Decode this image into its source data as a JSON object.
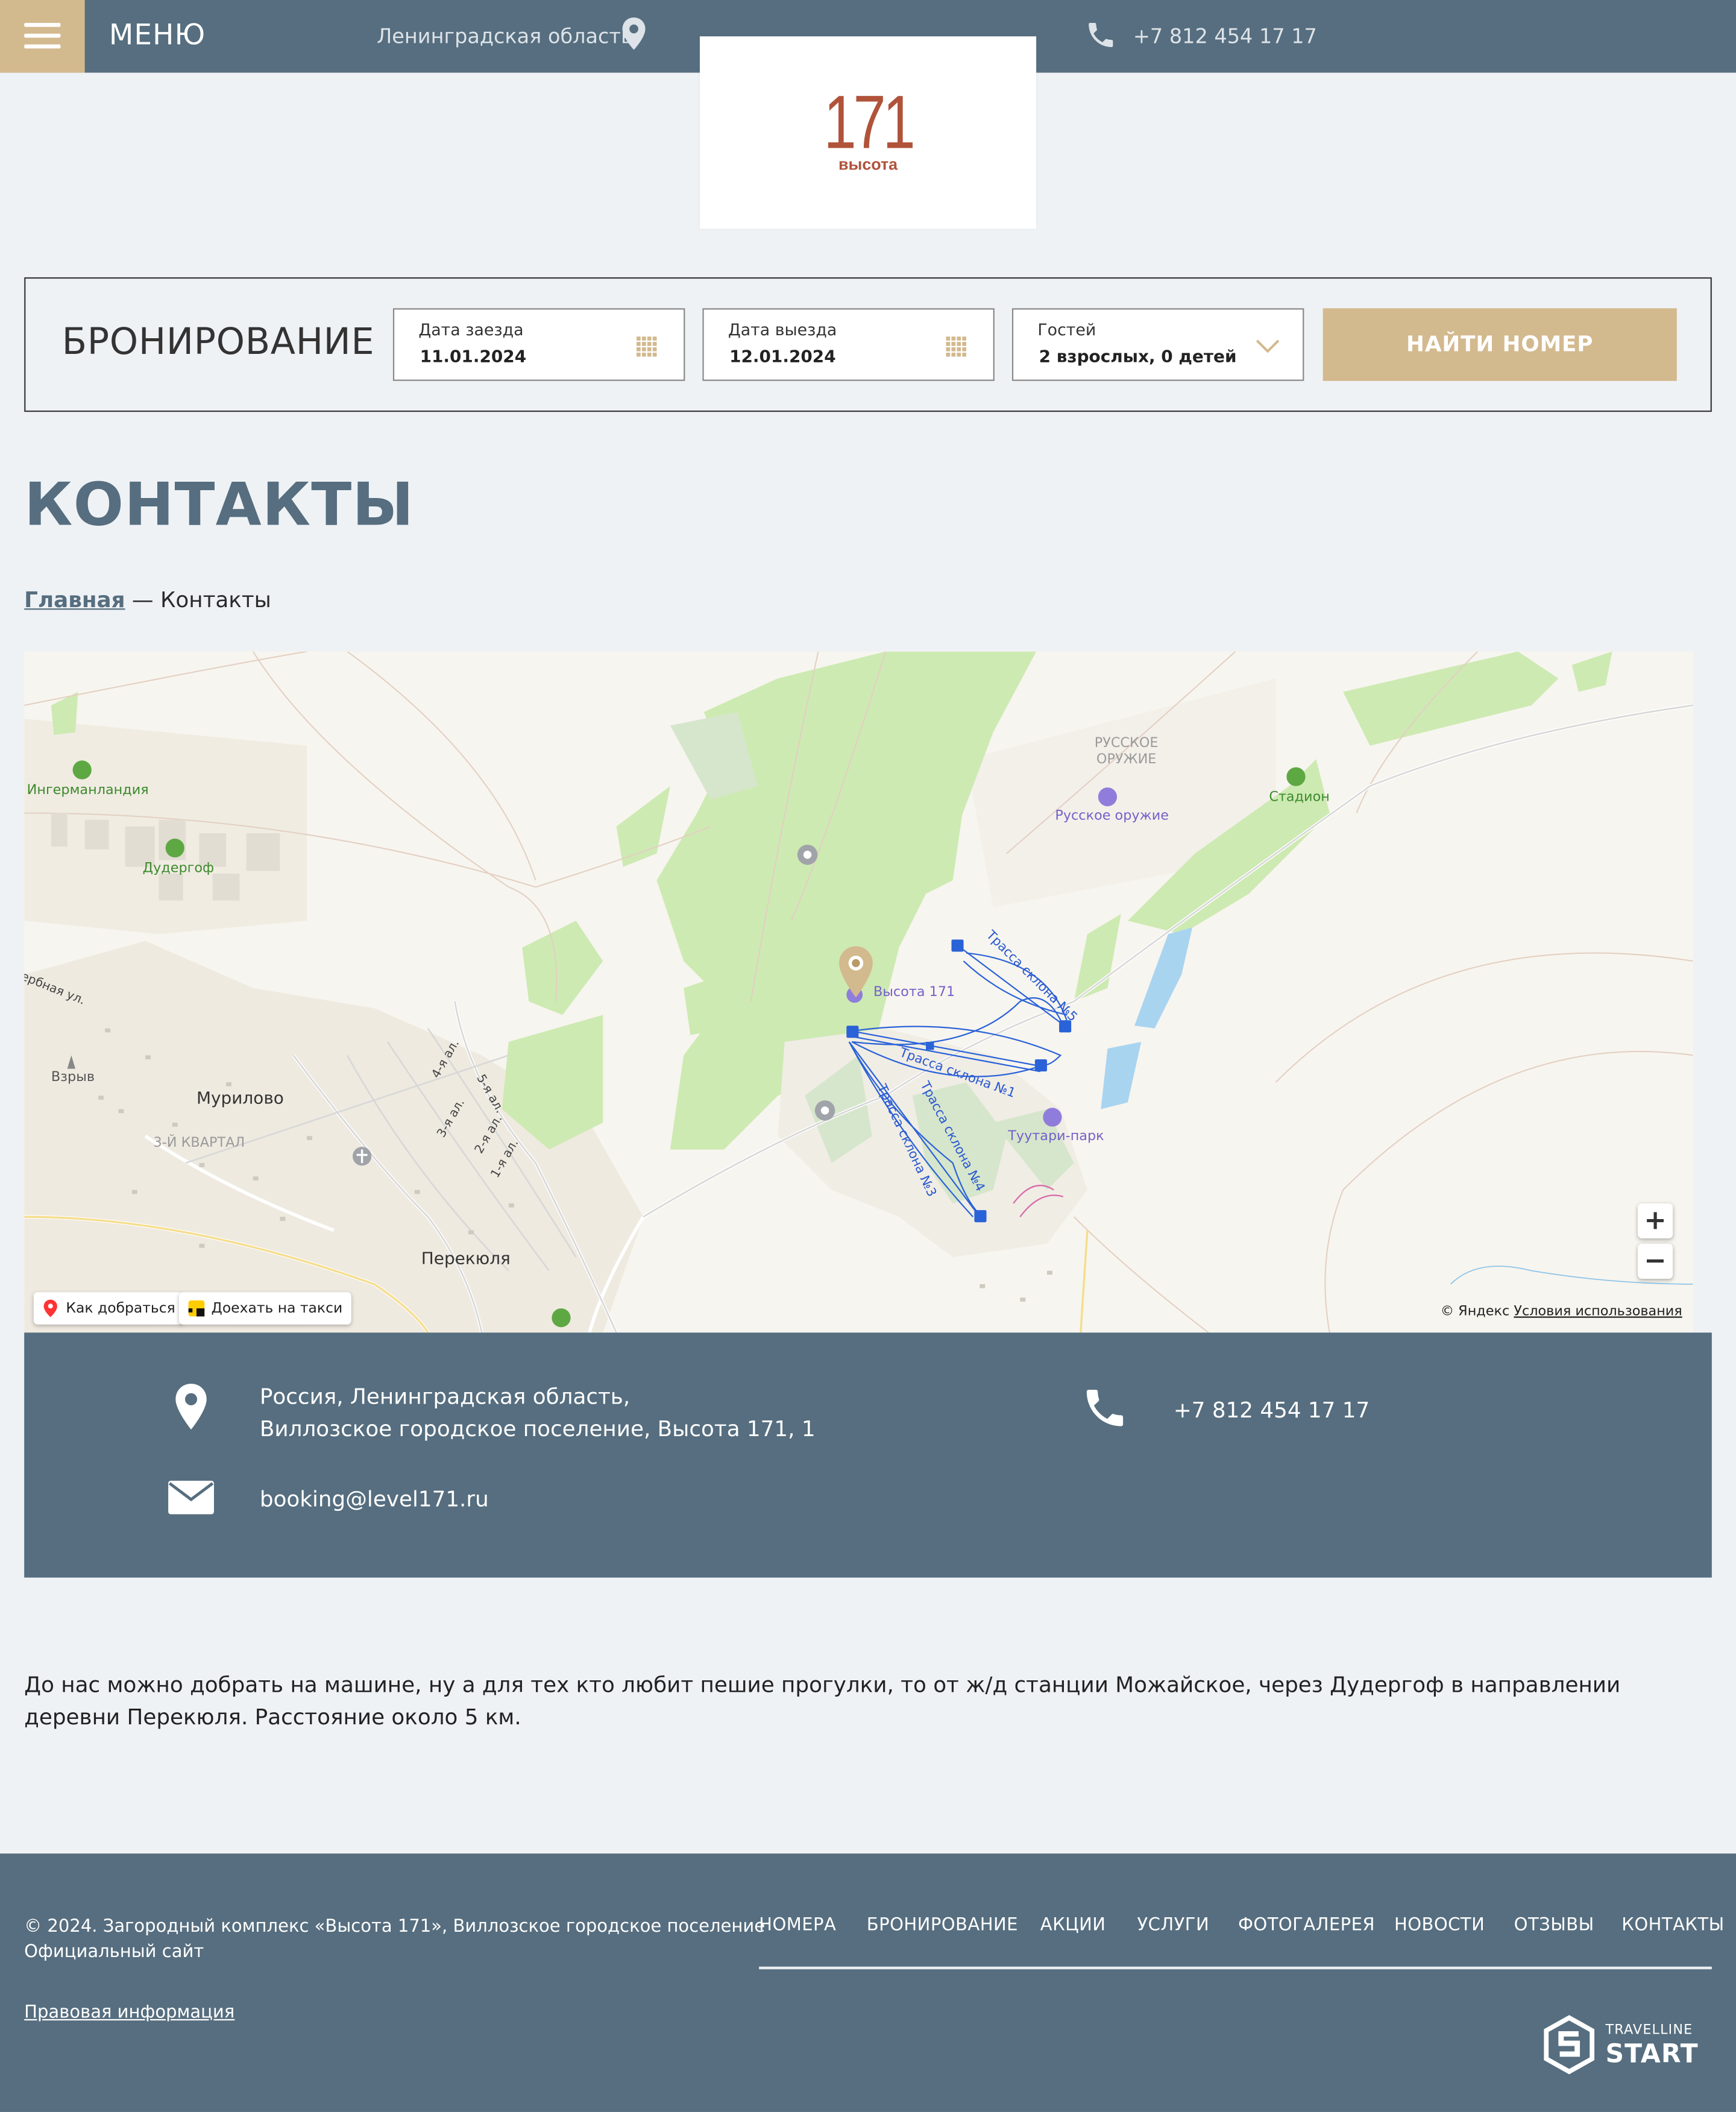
{
  "header": {
    "menu_label": "МЕНЮ",
    "region": "Ленинградская область",
    "phone": "+7 812 454 17 17"
  },
  "logo": {
    "number": "171",
    "word": "высота"
  },
  "booking": {
    "title": "БРОНИРОВАНИЕ",
    "checkin_label": "Дата заезда",
    "checkin_value": "11.01.2024",
    "checkout_label": "Дата выезда",
    "checkout_value": "12.01.2024",
    "guests_label": "Гостей",
    "guests_value": "2 взрослых, 0 детей",
    "find_button": "НАЙТИ НОМЕР"
  },
  "page_title": "КОНТАКТЫ",
  "breadcrumb": {
    "home": "Главная",
    "separator": " — ",
    "current": "Контакты"
  },
  "map": {
    "places": {
      "ingermanlandia": "Ингерманландия",
      "dudergof": "Дудергоф",
      "russkoe_oruzhie_area": "РУССКОЕ ОРУЖИЕ",
      "russkoe_oruzhie_poi": "Русское оружие",
      "stadion": "Стадион",
      "vysota": "Высота 171",
      "tuutari": "Туутари-парк",
      "murilovo": "Мурилово",
      "kvartal": "3-Й КВАРТАЛ",
      "vzryv": "Взрыв",
      "perekyulya": "Перекюля",
      "street_1": "1-я ал.",
      "street_2": "2-я ал.",
      "street_3": "3-я ал.",
      "street_4": "4-я ал.",
      "street_5": "5-я ал.",
      "street_serbnaya": "ербная ул.",
      "trail_1": "Трасса склона №1",
      "trail_3": "Трасса склона №3",
      "trail_4": "Трасса склона №4",
      "trail_5": "Трасса склона №5"
    },
    "route_button": "Как добраться",
    "taxi_button": "Доехать на такси",
    "zoom_in": "+",
    "zoom_out": "−",
    "copyright": "© Яндекс",
    "terms": "Условия использования"
  },
  "contacts": {
    "address_line1": "Россия, Ленинградская область,",
    "address_line2": "Виллозское городское поселение, Высота 171, 1",
    "phone": "+7 812 454 17 17",
    "email": "booking@level171.ru"
  },
  "description": "До нас можно добрать на машине, ну а для тех кто любит пешие прогулки, то от ж/д станции Можайское, через Дудергоф в направлении деревни Перекюля. Расстояние около 5 км.",
  "footer": {
    "copyright_line1": "© 2024. Загородный комплекс «Высота 171», Виллозское городское поселение",
    "copyright_line2": "Официальный сайт",
    "legal_link": "Правовая информация",
    "nav": [
      "НОМЕРА",
      "БРОНИРОВАНИЕ",
      "АКЦИИ",
      "УСЛУГИ",
      "ФОТОГАЛЕРЕЯ",
      "НОВОСТИ",
      "ОТЗЫВЫ",
      "КОНТАКТЫ"
    ],
    "tl_small": "TRAVELLINE",
    "tl_big": "START"
  },
  "colors": {
    "slate": "#566e7f",
    "gold": "#d3b98e",
    "brand_red": "#b0533a",
    "background": "#eff2f5"
  },
  "icons": [
    "menu-icon",
    "location-pin-icon",
    "phone-icon",
    "calendar-icon",
    "chevron-down-icon",
    "map-pin-icon",
    "mail-icon",
    "taxi-icon",
    "travelline-logo-icon"
  ]
}
